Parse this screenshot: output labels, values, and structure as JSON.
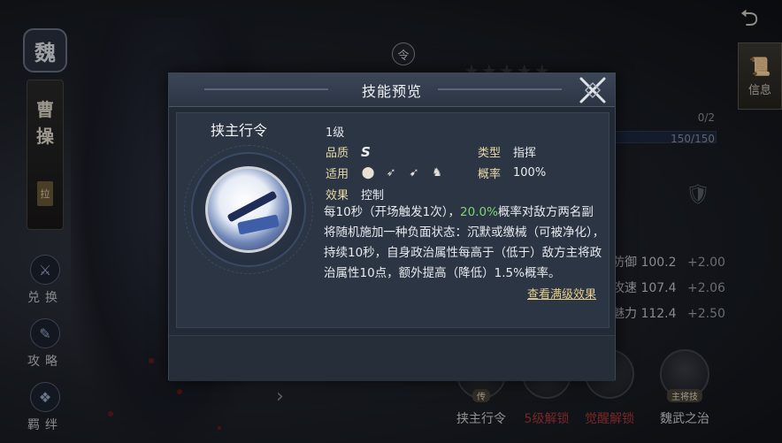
{
  "background": {
    "faction_char": "魏",
    "general_name": [
      "曹",
      "操"
    ],
    "rank_char": "拉",
    "side_buttons": [
      {
        "label": "兑换",
        "icon": "exchange-icon"
      },
      {
        "label": "攻略",
        "icon": "guide-icon"
      },
      {
        "label": "羁绊",
        "icon": "bond-icon"
      }
    ],
    "order_token": "令",
    "info_label": "信息",
    "back_glyph": "⮌",
    "exp_top": "0/2",
    "exp_bottom": "150/150",
    "stats": [
      {
        "name": "防御",
        "value": "100.2",
        "bonus": "+2.00"
      },
      {
        "name": "攻速",
        "value": "107.4",
        "bonus": "+2.06"
      },
      {
        "name": "魅力",
        "value": "112.4",
        "bonus": "+2.50"
      }
    ],
    "skills": [
      {
        "label": "挟主行令",
        "tag": "传",
        "color": "#d8d8d8"
      },
      {
        "label": "5级解锁",
        "tag": "",
        "color": "#b23a3a"
      },
      {
        "label": "觉醒解锁",
        "tag": "",
        "color": "#b23a3a"
      },
      {
        "label": "魏武之治",
        "tag": "主将技",
        "color": "#d8d8d8"
      }
    ]
  },
  "modal": {
    "title": "技能预览",
    "skill_name": "挟主行令",
    "level": "1级",
    "quality_label": "品质",
    "quality_value": "S",
    "type_label": "类型",
    "type_value": "指挥",
    "applies_label": "适用",
    "applies_icons": [
      "shield-troop-icon",
      "bow-troop-icon",
      "spear-troop-icon",
      "cavalry-troop-icon"
    ],
    "rate_label": "概率",
    "rate_value": "100%",
    "effect_label": "效果",
    "effect_value": "控制",
    "desc_before": "每10秒（开场触发1次），",
    "desc_highlight": "20.0%",
    "desc_after": "概率对敌方两名副将随机施加一种负面状态：沉默或缴械（可被净化），持续10秒，自身政治属性每高于（低于）敌方主将政治属性10点，额外提高（降低）1.5%概率。",
    "view_max_link": "查看满级效果",
    "colors": {
      "highlight": "#7bd86f",
      "key": "#e8d9a6",
      "link": "#e6cf8b"
    }
  }
}
